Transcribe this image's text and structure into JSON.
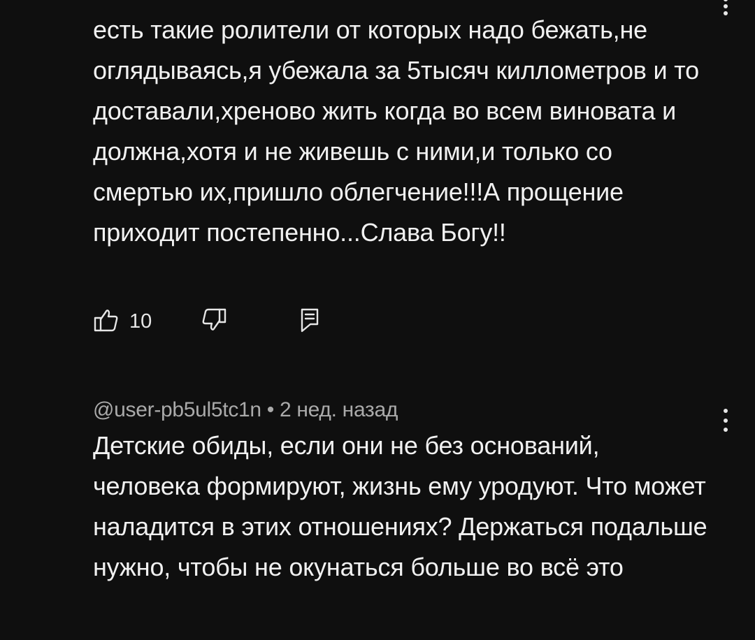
{
  "comments": [
    {
      "author": "",
      "time": "",
      "text": "есть такие ролители от которых надо бежать,не оглядываясь,я убежала за 5тысяч киллометров и то доставали,хреново жить когда во всем виновата и должна,хотя и не живешь с ними,и только со смертью их,пришло облегчение!!!А прощение приходит постепенно...Слава Богу!!",
      "likes": "10",
      "icons": {
        "like": "thumbs-up-icon",
        "dislike": "thumbs-down-icon",
        "reply": "reply-icon",
        "menu": "more-vert-icon"
      }
    },
    {
      "author": "@user-pb5ul5tc1n",
      "separator": "•",
      "time": "2 нед. назад",
      "text": "Детские обиды, если они не без оснований, человека формируют, жизнь ему уродуют. Что может наладится в этих отношениях? Держаться подальше нужно, чтобы не окунаться больше во всё это",
      "icons": {
        "menu": "more-vert-icon"
      }
    }
  ],
  "colors": {
    "background": "#0f0f0f",
    "text": "#f1f1f1",
    "meta": "#aaaaaa"
  }
}
